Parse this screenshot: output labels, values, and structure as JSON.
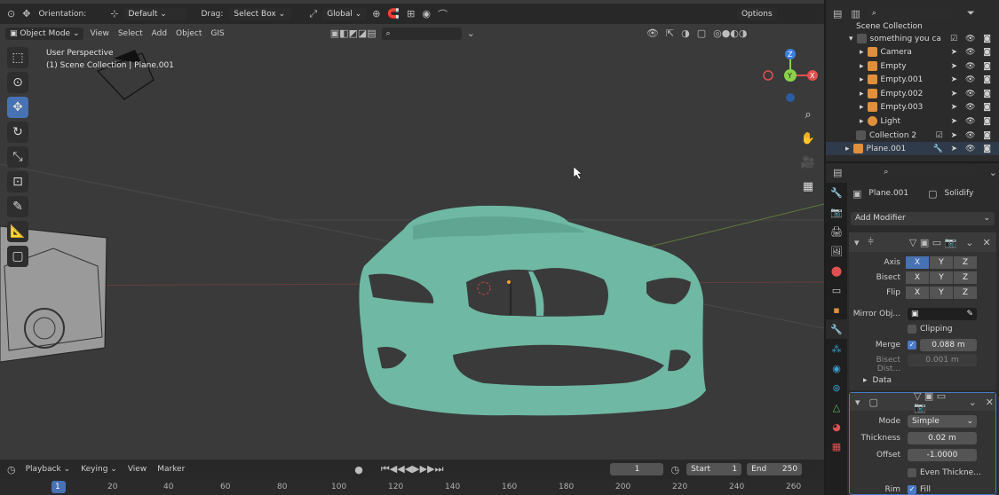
{
  "header": {
    "orientation_label": "Orientation:",
    "orientation_value": "Default",
    "drag_label": "Drag:",
    "drag_value": "Select Box",
    "transform_space": "Global",
    "options": "Options"
  },
  "header2": {
    "mode": "Object Mode",
    "menus": [
      "View",
      "Select",
      "Add",
      "Object",
      "GIS"
    ]
  },
  "viewport": {
    "perspective": "User Perspective",
    "collection_path": "(1) Scene Collection | Plane.001",
    "model_color": "#6fb8a3"
  },
  "outliner": {
    "root": "Scene Collection",
    "items": [
      {
        "name": "something you ca",
        "color": "#cfcfcf"
      },
      {
        "name": "Camera",
        "color": "#e0903a"
      },
      {
        "name": "Empty",
        "color": "#e0903a"
      },
      {
        "name": "Empty.001",
        "color": "#e0903a"
      },
      {
        "name": "Empty.002",
        "color": "#e0903a"
      },
      {
        "name": "Empty.003",
        "color": "#e0903a"
      },
      {
        "name": "Light",
        "color": "#e0903a"
      },
      {
        "name": "Collection 2",
        "color": "#cfcfcf"
      },
      {
        "name": "Plane.001",
        "color": "#e0903a"
      }
    ]
  },
  "properties": {
    "object": "Plane.001",
    "modifier_name": "Solidify",
    "add_modifier": "Add Modifier",
    "mirror": {
      "axis_label": "Axis",
      "bisect_label": "Bisect",
      "flip_label": "Flip",
      "axes": [
        "X",
        "Y",
        "Z"
      ],
      "mirror_object_label": "Mirror Obj...",
      "clipping_label": "Clipping",
      "merge_label": "Merge",
      "merge_value": "0.088 m",
      "bisect_dist_label": "Bisect Dist...",
      "bisect_dist_value": "0.001 m",
      "data_label": "Data"
    },
    "solidify": {
      "mode_label": "Mode",
      "mode_value": "Simple",
      "thickness_label": "Thickness",
      "thickness_value": "0.02 m",
      "offset_label": "Offset",
      "offset_value": "-1.0000",
      "even_label": "Even Thickne...",
      "rim_label": "Rim",
      "fill_label": "Fill"
    }
  },
  "timeline": {
    "menus": [
      "Playback",
      "Keying",
      "View",
      "Marker"
    ],
    "current_frame": "1",
    "start_label": "Start",
    "start_value": "1",
    "end_label": "End",
    "end_value": "250",
    "ticks": [
      "1",
      "20",
      "40",
      "60",
      "80",
      "100",
      "120",
      "140",
      "160",
      "180",
      "200",
      "220",
      "240",
      "260"
    ]
  }
}
